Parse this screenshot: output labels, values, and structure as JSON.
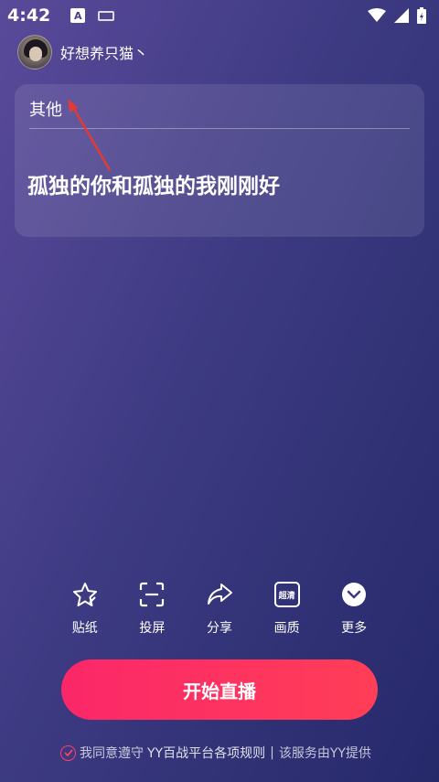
{
  "status_bar": {
    "time": "4:42",
    "a_icon": "A"
  },
  "user": {
    "name": "好想养只猫丶"
  },
  "card": {
    "category": "其他",
    "title": "孤独的你和孤独的我刚刚好"
  },
  "tools": [
    {
      "label": "贴纸",
      "icon": "sticker-icon"
    },
    {
      "label": "投屏",
      "icon": "screen-cast-icon"
    },
    {
      "label": "分享",
      "icon": "share-icon"
    },
    {
      "label": "画质",
      "icon": "quality-icon",
      "badge": "超清"
    },
    {
      "label": "更多",
      "icon": "more-icon"
    }
  ],
  "start_button": {
    "label": "开始直播"
  },
  "agreement": {
    "prefix": "我同意遵守",
    "link": "YY百战平台各项规则",
    "separator": "|",
    "suffix": "该服务由YY提供"
  },
  "colors": {
    "accent": "#fb2769",
    "background_start": "#5a4a9a",
    "background_end": "#25296a",
    "annotation_arrow": "#e53935"
  }
}
